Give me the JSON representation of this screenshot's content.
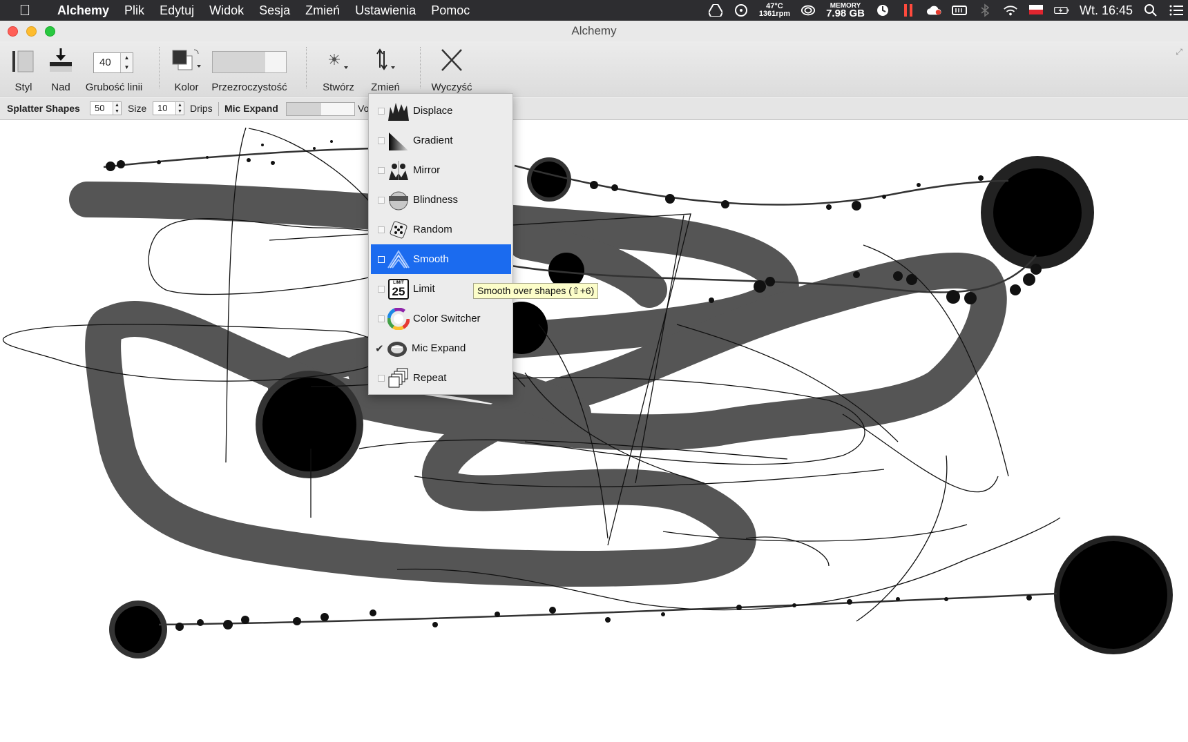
{
  "menubar": {
    "app_name": "Alchemy",
    "menus": [
      "Plik",
      "Edytuj",
      "Widok",
      "Sesja",
      "Zmień",
      "Ustawienia",
      "Pomoc"
    ],
    "status": {
      "temp": "47°C",
      "rpm": "1361rpm",
      "memory_label": "MEMORY",
      "memory_value": "7.98 GB",
      "clock": "Wt. 16:45"
    }
  },
  "window": {
    "title": "Alchemy"
  },
  "toolbar": {
    "style_label": "Styl",
    "over_label": "Nad",
    "line_width_value": "40",
    "line_width_label": "Grubość linii",
    "color_label": "Kolor",
    "transparency_label": "Przezroczystość",
    "create_label": "Stwórz",
    "affect_label": "Zmień",
    "clear_label": "Wyczyść"
  },
  "subbar": {
    "module_name": "Splatter Shapes",
    "shapes_value": "50",
    "size_label": "Size",
    "size_value": "10",
    "drips_label": "Drips",
    "mic_label": "Mic Expand",
    "vol_label_partial": "Vo"
  },
  "dropdown": {
    "items": [
      {
        "label": "Displace",
        "icon": "displace-icon",
        "checked": false
      },
      {
        "label": "Gradient",
        "icon": "gradient-icon",
        "checked": false
      },
      {
        "label": "Mirror",
        "icon": "mirror-icon",
        "checked": false
      },
      {
        "label": "Blindness",
        "icon": "blindness-icon",
        "checked": false
      },
      {
        "label": "Random",
        "icon": "random-dice-icon",
        "checked": false
      },
      {
        "label": "Smooth",
        "icon": "smooth-icon",
        "checked": false,
        "selected": true
      },
      {
        "label": "Limit",
        "icon": "limit-25-icon",
        "checked": false
      },
      {
        "label": "Color Switcher",
        "icon": "color-wheel-icon",
        "checked": false
      },
      {
        "label": "Mic Expand",
        "icon": "mic-mouth-icon",
        "checked": true
      },
      {
        "label": "Repeat",
        "icon": "repeat-stack-icon",
        "checked": false
      }
    ],
    "limit_icon_text_top": "LIMIT",
    "limit_icon_text_num": "25"
  },
  "tooltip": {
    "text": "Smooth over shapes (⇧+6)"
  },
  "colors": {
    "accent": "#1b6bef",
    "stroke_gray": "#555555",
    "ink": "#000000"
  }
}
